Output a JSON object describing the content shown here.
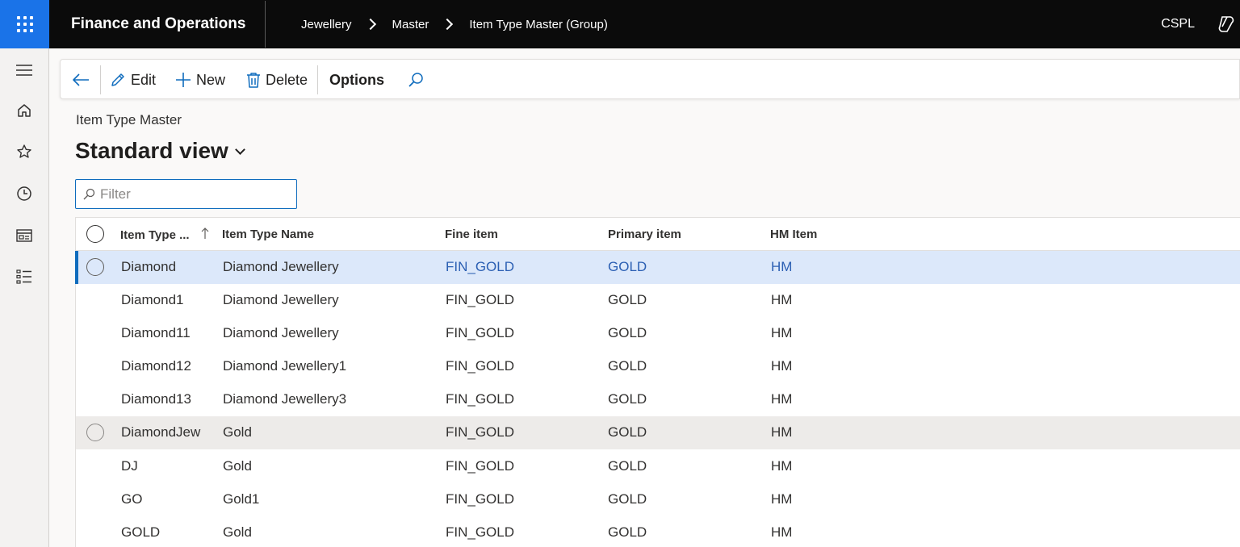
{
  "topbar": {
    "app_title": "Finance and Operations",
    "breadcrumbs": [
      "Jewellery",
      "Master",
      "Item Type Master (Group)"
    ],
    "company": "CSPL"
  },
  "leftnav": {
    "items": [
      "hamburger-icon",
      "home-icon",
      "star-icon",
      "clock-icon",
      "workspace-icon",
      "list-icon"
    ]
  },
  "actions": {
    "edit": "Edit",
    "new": "New",
    "delete": "Delete",
    "options": "Options"
  },
  "page": {
    "subtitle": "Item Type Master",
    "view_title": "Standard view"
  },
  "filter": {
    "placeholder": "Filter",
    "value": ""
  },
  "grid": {
    "columns": [
      "Item Type ...",
      "Item Type Name",
      "Fine item",
      "Primary item",
      "HM Item"
    ],
    "rows": [
      {
        "item_type": "Diamond",
        "name": "Diamond Jewellery",
        "fine": "FIN_GOLD",
        "primary": "GOLD",
        "hm": "HM"
      },
      {
        "item_type": "Diamond1",
        "name": "Diamond Jewellery",
        "fine": "FIN_GOLD",
        "primary": "GOLD",
        "hm": "HM"
      },
      {
        "item_type": "Diamond11",
        "name": "Diamond Jewellery",
        "fine": "FIN_GOLD",
        "primary": "GOLD",
        "hm": "HM"
      },
      {
        "item_type": "Diamond12",
        "name": "Diamond Jewellery1",
        "fine": "FIN_GOLD",
        "primary": "GOLD",
        "hm": "HM"
      },
      {
        "item_type": "Diamond13",
        "name": "Diamond Jewellery3",
        "fine": "FIN_GOLD",
        "primary": "GOLD",
        "hm": "HM"
      },
      {
        "item_type": "DiamondJew",
        "name": "Gold",
        "fine": "FIN_GOLD",
        "primary": "GOLD",
        "hm": "HM"
      },
      {
        "item_type": "DJ",
        "name": "Gold",
        "fine": "FIN_GOLD",
        "primary": "GOLD",
        "hm": "HM"
      },
      {
        "item_type": "GO",
        "name": "Gold1",
        "fine": "FIN_GOLD",
        "primary": "GOLD",
        "hm": "HM"
      },
      {
        "item_type": "GOLD",
        "name": "Gold",
        "fine": "FIN_GOLD",
        "primary": "GOLD",
        "hm": "HM"
      }
    ]
  },
  "colors": {
    "accent": "#0f6cbd",
    "waffle_bg": "#1a73e8",
    "topbar_bg": "#0b0b0b",
    "selected_row": "#dce8fa",
    "hover_row": "#edebe9"
  }
}
